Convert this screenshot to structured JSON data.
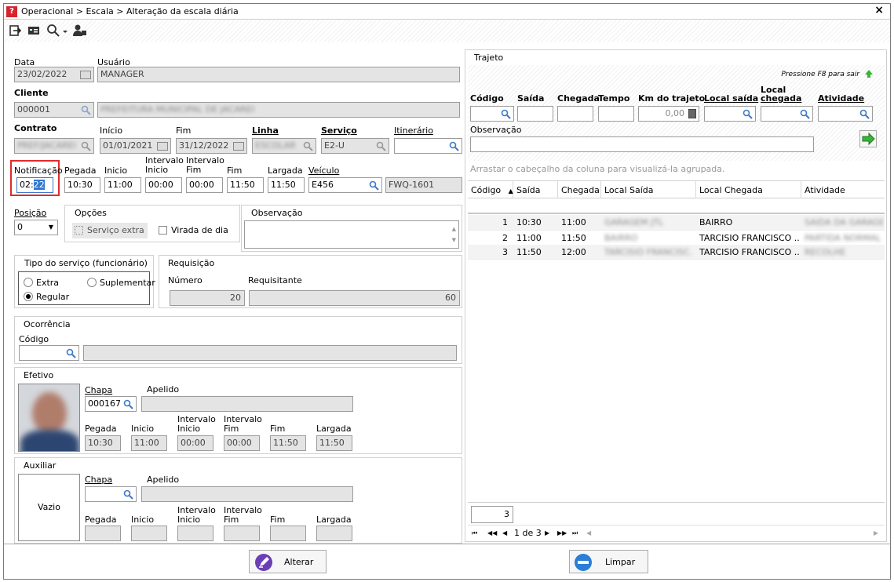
{
  "window": {
    "title": "Operacional > Escala > Alteração da escala diária",
    "close": "×"
  },
  "toolbar": {
    "icons": [
      "exit-icon",
      "id-card-icon",
      "search-dropdown-icon",
      "user-icon"
    ]
  },
  "form": {
    "data_label": "Data",
    "data_value": "23/02/2022",
    "usuario_label": "Usuário",
    "usuario_value": "MANAGER",
    "cliente_label": "Cliente",
    "cliente_code": "000001",
    "cliente_name": "PREFEITURA MUNICIPAL DE JACAREI",
    "contrato_label": "Contrato",
    "contrato_value": "PREF/JACAREI",
    "inicio_label": "Início",
    "inicio_value": "01/01/2021",
    "fim_label": "Fim",
    "fim_value": "31/12/2022",
    "linha_label": "Linha",
    "linha_value": "ESCOLAR",
    "servico_label": "Serviço",
    "servico_value": "E2-U",
    "itinerario_label": "Itinerário",
    "itinerario_value": "",
    "notificacao_label": "Notificação",
    "notificacao_value_a": "02:",
    "notificacao_value_b": "22",
    "pegada_label": "Pegada",
    "pegada_value": "10:30",
    "inicio2_label": "Inicio",
    "inicio2_value": "11:00",
    "int_inicio_label1": "Intervalo",
    "int_inicio_label2": "Inicio",
    "int_inicio_value": "00:00",
    "int_fim_label1": "Intervalo",
    "int_fim_label2": "Fim",
    "int_fim_value": "00:00",
    "fim2_label": "Fim",
    "fim2_value": "11:50",
    "largada_label": "Largada",
    "largada_value": "11:50",
    "veiculo_label": "Veículo",
    "veiculo_value": "E456",
    "veiculo_plate": "FWQ-1601",
    "posicao_label": "Posição",
    "posicao_value": "0",
    "opcoes_label": "Opções",
    "servico_extra": "Serviço extra",
    "virada_dia": "Virada de dia",
    "observacao_label": "Observação",
    "tipo_servico_label": "Tipo do serviço (funcionário)",
    "extra": "Extra",
    "suplementar": "Suplementar",
    "regular": "Regular",
    "requisicao_label": "Requisição",
    "numero_label": "Número",
    "numero_value": "20",
    "requisitante_label": "Requisitante",
    "requisitante_value": "60",
    "ocorrencia_label": "Ocorrência",
    "codigo_label": "Código",
    "efetivo_label": "Efetivo",
    "chapa_label": "Chapa",
    "chapa_value": "000167",
    "apelido_label": "Apelido",
    "ef_pegada": "Pegada",
    "ef_inicio": "Inicio",
    "ef_int1": "Intervalo",
    "ef_int_ini": "Inicio",
    "ef_int2": "Intervalo",
    "ef_int_fim": "Fim",
    "ef_fim": "Fim",
    "ef_largada": "Largada",
    "ef_pegada_v": "10:30",
    "ef_inicio_v": "11:00",
    "ef_int_ini_v": "00:00",
    "ef_int_fim_v": "00:00",
    "ef_fim_v": "11:50",
    "ef_largada_v": "11:50",
    "auxiliar_label": "Auxiliar",
    "vazio": "Vazio"
  },
  "trajeto": {
    "title": "Trajeto",
    "hint": "Pressione F8 para sair",
    "codigo": "Código",
    "saida": "Saída",
    "chegada": "Chegada",
    "tempo": "Tempo",
    "km": "Km do trajeto",
    "km_value": "0,00",
    "local_saida": "Local saída",
    "local_chegada1": "Local",
    "local_chegada2": "chegada",
    "atividade": "Atividade",
    "observacao": "Observação",
    "group_hint": "Arrastar o cabeçalho da coluna para visualizá-la agrupada.",
    "columns": [
      "Código",
      "Saída",
      "Chegada",
      "Local Saída",
      "Local Chegada",
      "Atividade"
    ],
    "rows": [
      {
        "codigo": "1",
        "saida": "10:30",
        "chegada": "11:00",
        "local_saida": "GARAGEM JTL",
        "local_chegada": "BAIRRO",
        "atividade": "SAIDA DA GARAGEM"
      },
      {
        "codigo": "2",
        "saida": "11:00",
        "chegada": "11:50",
        "local_saida": "BAIRRO",
        "local_chegada": "TARCISIO FRANCISCO ...",
        "atividade": "PARTIDA NORMAL"
      },
      {
        "codigo": "3",
        "saida": "11:50",
        "chegada": "12:00",
        "local_saida": "TARCISIO FRANCISC...",
        "local_chegada": "TARCISIO FRANCISCO ...",
        "atividade": "RECOLHE"
      }
    ],
    "count": "3",
    "pager": "1 de 3"
  },
  "buttons": {
    "alterar": "Alterar",
    "limpar": "Limpar"
  }
}
